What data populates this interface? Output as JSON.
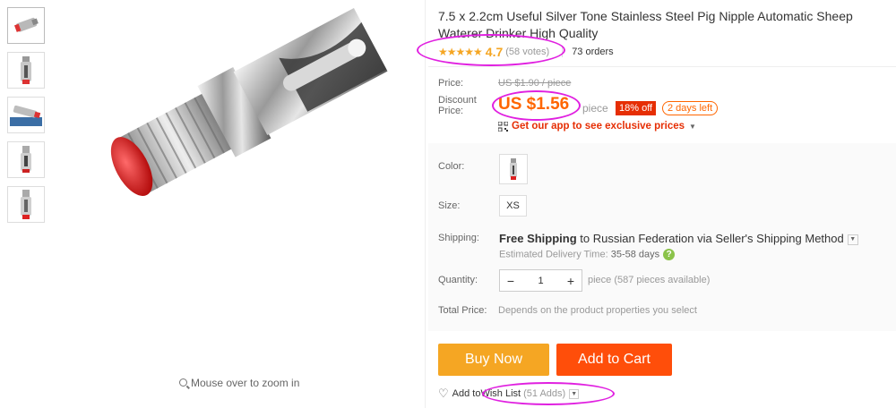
{
  "thumbnails": [
    {
      "label": "thumbnail-1"
    },
    {
      "label": "thumbnail-2"
    },
    {
      "label": "thumbnail-3"
    },
    {
      "label": "thumbnail-4"
    },
    {
      "label": "thumbnail-5"
    }
  ],
  "gallery": {
    "zoom_hint": "Mouse over to zoom in"
  },
  "product": {
    "title": "7.5 x 2.2cm Useful Silver Tone Stainless Steel Pig Nipple Automatic Sheep Waterer Drinker High Quality",
    "stars": "★★★★★",
    "rating": "4.7",
    "votes": "(58 votes)",
    "orders": "73 orders"
  },
  "pricing": {
    "price_label": "Price:",
    "original_price": "US $1.90 / piece",
    "discount_label_line1": "Discount",
    "discount_label_line2": "Price:",
    "discount_price": "US $1.56",
    "unit": "piece",
    "discount_badge": "18% off",
    "time_left": "2 days left",
    "app_promo": "Get our app to see exclusive prices"
  },
  "options": {
    "color_label": "Color:",
    "size_label": "Size:",
    "size_value": "XS",
    "shipping_label": "Shipping:",
    "shipping_bold": "Free Shipping",
    "shipping_to": " to ",
    "shipping_dest": "Russian Federation via Seller's Shipping Method",
    "delivery_label": "Estimated Delivery Time: ",
    "delivery_days": "35-58 days",
    "help": "?",
    "quantity_label": "Quantity:",
    "quantity_minus": "−",
    "quantity_value": "1",
    "quantity_plus": "+",
    "quantity_note": "piece (587 pieces available)",
    "total_label": "Total Price:",
    "total_note": "Depends on the product properties you select"
  },
  "actions": {
    "buy_now": "Buy Now",
    "add_to_cart": "Add to Cart",
    "wishlist_prefix": "Add to ",
    "wishlist_link": "Wish List",
    "wishlist_count": "(51 Adds)"
  },
  "colors": {
    "price_orange": "#ff6600",
    "buy_now_bg": "#f5a623",
    "add_to_cart_bg": "#ff4e0a",
    "badge_red": "#e62e04",
    "annotation_magenta": "#e020e0"
  }
}
